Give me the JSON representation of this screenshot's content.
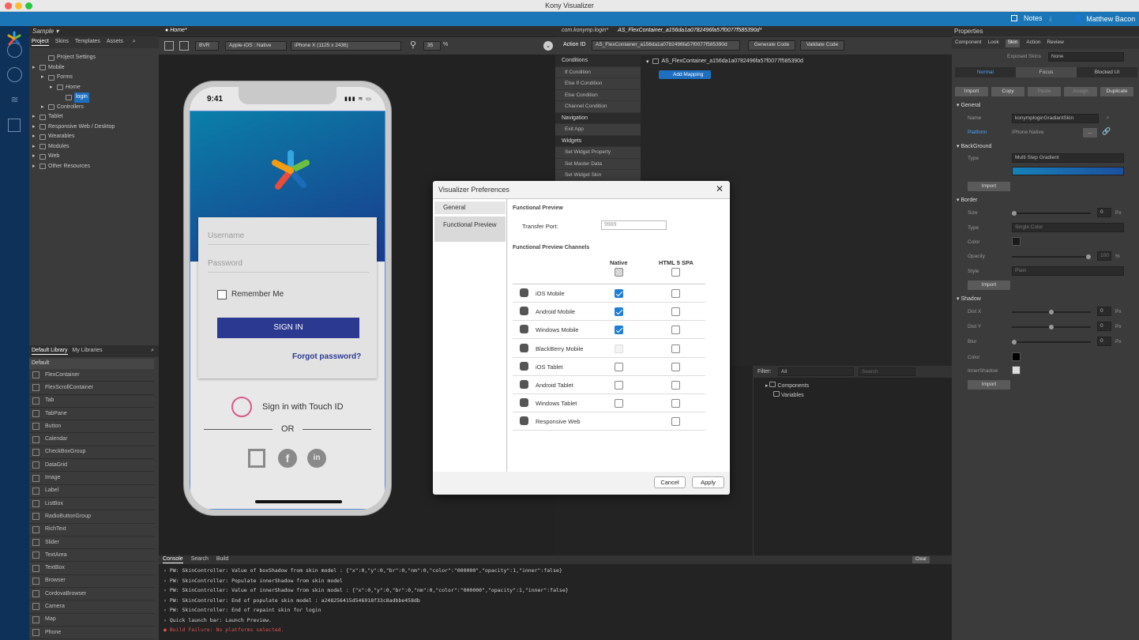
{
  "window": {
    "title": "Kony Visualizer"
  },
  "topbar": {
    "notes": "Notes",
    "user": "Matthew Bacon"
  },
  "project": {
    "name": "Sample",
    "tabs": [
      "Project",
      "Skins",
      "Templates",
      "Assets"
    ],
    "tree": [
      {
        "label": "Project Settings",
        "indent": 1
      },
      {
        "label": "Mobile",
        "indent": 0
      },
      {
        "label": "Forms",
        "indent": 1
      },
      {
        "label": "Home",
        "indent": 2
      },
      {
        "label": "login",
        "indent": 3
      },
      {
        "label": "Controllers",
        "indent": 1
      },
      {
        "label": "Tablet",
        "indent": 0
      },
      {
        "label": "Responsive Web / Desktop",
        "indent": 0
      },
      {
        "label": "Wearables",
        "indent": 0
      },
      {
        "label": "Modules",
        "indent": 0
      },
      {
        "label": "Web",
        "indent": 0
      },
      {
        "label": "Other Resources",
        "indent": 0
      }
    ]
  },
  "library": {
    "tabs": [
      "Default Library",
      "My Libraries"
    ],
    "section": "Default",
    "items": [
      "FlexContainer",
      "FlexScrollContainer",
      "Tab",
      "TabPane",
      "Button",
      "Calendar",
      "CheckBoxGroup",
      "DataGrid",
      "Image",
      "Label",
      "ListBox",
      "RadioButtonGroup",
      "RichText",
      "Slider",
      "TextArea",
      "TextBox",
      "Browser",
      "CordovaBrowser",
      "Camera",
      "Map",
      "Phone"
    ]
  },
  "canvas": {
    "tab": "Home*",
    "bvr": "BVR",
    "platform": "Apple-iOS : Native",
    "device": "iPhone X (1125 x 2436)",
    "zoom": "35",
    "zoom_unit": "%"
  },
  "phone": {
    "time": "9:41",
    "username": "Username",
    "password": "Password",
    "remember": "Remember Me",
    "signin": "SIGN IN",
    "forgot": "Forgot password?",
    "touchid": "Sign in with Touch ID",
    "or": "OR"
  },
  "action": {
    "tabs": [
      "com.konymp.login*",
      "AS_FlexContainer_a156da1a0782496fa57f0077f585390d*"
    ],
    "id_label": "Action ID",
    "id_value": "AS_FlexContainer_a156da1a0782496fa57f0077f585390d",
    "generate": "Generate Code",
    "validate": "Validate Code",
    "node": "AS_FlexContainer_a156da1a0782496fa57f0077f585390d",
    "add_mapping": "Add Mapping",
    "list": [
      {
        "t": "Conditions",
        "sec": true
      },
      {
        "t": "If Condition"
      },
      {
        "t": "Else If Condition"
      },
      {
        "t": "Else Condition"
      },
      {
        "t": "Channel Condition"
      },
      {
        "t": "Navigation",
        "sec": true
      },
      {
        "t": "Exit App"
      },
      {
        "t": "Widgets",
        "sec": true
      },
      {
        "t": "Set Widget Property"
      },
      {
        "t": "Set Master Data"
      },
      {
        "t": "Set Widget Skin"
      }
    ]
  },
  "filter": {
    "label": "Filter:",
    "value": "All",
    "search": "Search",
    "items": [
      "Components",
      "Variables"
    ]
  },
  "console": {
    "tabs": [
      "Console",
      "Search",
      "Build"
    ],
    "clear": "Clear",
    "lines": [
      {
        "t": "PW: SkinController: Value of boxShadow from skin model : {\"x\":0,\"y\":0,\"br\":0,\"nm\":0,\"color\":\"000000\",\"opacity\":1,\"inner\":false}"
      },
      {
        "t": "PW: SkinController: Populate innerShadow from skin model"
      },
      {
        "t": "PW: SkinController: Value of innerShadow from skin model : {\"x\":0,\"y\":0,\"br\":0,\"nm\":0,\"color\":\"000000\",\"opacity\":1,\"inner\":false}"
      },
      {
        "t": "PW: SkinController: End of populate skin model : a248256415d546918f33c8adbbe458db"
      },
      {
        "t": "PW: SkinController: End of repaint skin for login"
      },
      {
        "t": "Quick launch bar: Launch Preview."
      },
      {
        "t": "Build Failure: No platforms selected.",
        "err": true
      }
    ]
  },
  "props": {
    "title": "Properties",
    "tabs": [
      "Component",
      "Look",
      "Skin",
      "Action",
      "Review"
    ],
    "exposed_label": "Exposed Skins",
    "exposed_value": "None",
    "states": [
      "Normal",
      "Focus",
      "Blocked UI"
    ],
    "btns": [
      "Import",
      "Copy",
      "Paste",
      "Assign",
      "Duplicate"
    ],
    "general": "General",
    "name_label": "Name",
    "name_value": "konymploginGradiantSkin",
    "platform_label": "Platform",
    "platform_value": "iPhone Native",
    "platform_btn": "...",
    "background": "BackGround",
    "type_label": "Type",
    "type_value": "Multi Step Gradient",
    "import": "Import",
    "border": "Border",
    "size_label": "Size",
    "size_value": "0",
    "px": "Px",
    "btype_label": "Type",
    "btype_value": "Single Color",
    "color_label": "Color",
    "opacity_label": "Opacity",
    "opacity_value": "100",
    "pct": "%",
    "style_label": "Style",
    "style_value": "Plain",
    "shadow": "Shadow",
    "distx": "Dist X",
    "disty": "Dist Y",
    "blur": "Blur",
    "scolor": "Color",
    "inner": "InnerShadow",
    "zero": "0"
  },
  "dialog": {
    "title": "Visualizer Preferences",
    "nav": [
      "General",
      "Functional Preview"
    ],
    "section": "Functional Preview",
    "port_label": "Transfer Port:",
    "port_value": "9989",
    "channels": "Functional Preview Channels",
    "col_native": "Native",
    "col_html": "HTML 5 SPA",
    "rows": [
      {
        "name": "iOS Mobile",
        "native": "on",
        "html": "off"
      },
      {
        "name": "Android Mobile",
        "native": "on",
        "html": "off"
      },
      {
        "name": "Windows Mobile",
        "native": "on",
        "html": "off"
      },
      {
        "name": "BlackBerry Mobile",
        "native": "dis",
        "html": "off"
      },
      {
        "name": "iOS Tablet",
        "native": "off",
        "html": "off"
      },
      {
        "name": "Android Tablet",
        "native": "off",
        "html": "off"
      },
      {
        "name": "Windows Tablet",
        "native": "off",
        "html": "off"
      },
      {
        "name": "Responsive Web",
        "native": "none",
        "html": "off"
      }
    ],
    "cancel": "Cancel",
    "apply": "Apply"
  },
  "colors": {
    "brand_blue": "#1a76b6",
    "rail": "#0d3159",
    "accent": "#1f7fd6",
    "signin": "#2b3990",
    "gradient_top": "#0a7fa8",
    "gradient_bottom": "#1a3a8c"
  }
}
